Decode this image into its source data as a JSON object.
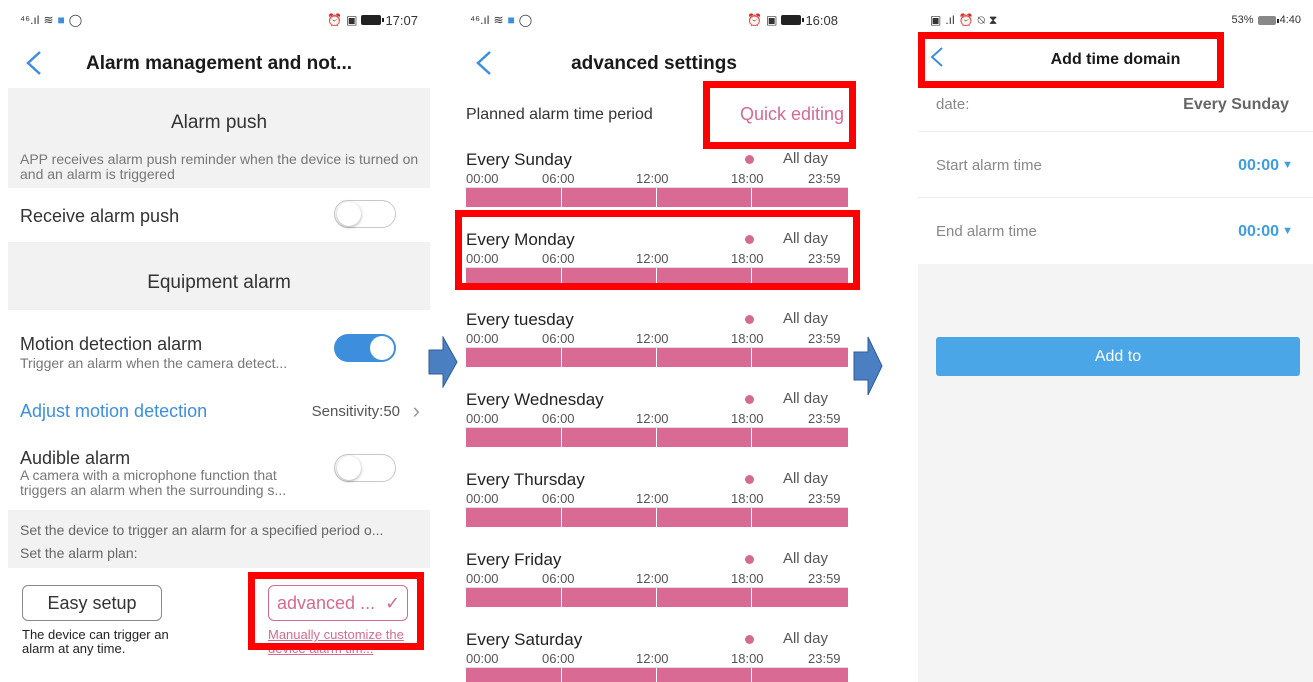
{
  "screen1": {
    "status": {
      "signal": "⁴⁶.ıl",
      "time": "17:07"
    },
    "title": "Alarm management and not...",
    "alarm_push": {
      "section_title": "Alarm push",
      "description": "APP receives alarm push reminder when the device is turned on and an alarm is triggered",
      "receive_label": "Receive alarm push",
      "receive_on": false
    },
    "equipment_alarm": {
      "section_title": "Equipment alarm",
      "motion_label": "Motion detection alarm",
      "motion_desc": "Trigger an alarm when the camera detect...",
      "motion_on": true,
      "adjust_label": "Adjust motion detection",
      "sensitivity": "Sensitivity:50",
      "audible_label": "Audible alarm",
      "audible_desc": "A camera with a microphone function that triggers an alarm when the surrounding s...",
      "audible_on": false
    },
    "plan": {
      "desc": "Set the device to trigger an alarm for a specified period o...",
      "label": "Set the alarm plan:",
      "easy_label": "Easy setup",
      "easy_desc": "The device can trigger an alarm at any time.",
      "advanced_label": "advanced ...",
      "advanced_desc": "Manually customize the device alarm tim..."
    }
  },
  "screen2": {
    "status": {
      "signal": "⁴⁶.ıl",
      "time": "16:08"
    },
    "title": "advanced settings",
    "plan_label": "Planned alarm time period",
    "quick_edit": "Quick editing",
    "all_day_label": "All day",
    "ticks": [
      "00:00",
      "06:00",
      "12:00",
      "18:00",
      "23:59"
    ],
    "days": [
      {
        "name": "Every Sunday"
      },
      {
        "name": "Every Monday"
      },
      {
        "name": "Every tuesday"
      },
      {
        "name": "Every Wednesday"
      },
      {
        "name": "Every Thursday"
      },
      {
        "name": "Every Friday"
      },
      {
        "name": "Every Saturday"
      }
    ]
  },
  "screen3": {
    "status": {
      "battery": "53%",
      "time": "4:40"
    },
    "title": "Add time domain",
    "date_label": "date:",
    "date_value": "Every Sunday",
    "start_label": "Start alarm time",
    "start_value": "00:00",
    "end_label": "End alarm time",
    "end_value": "00:00",
    "add_label": "Add to"
  },
  "colors": {
    "accent_blue": "#3d8fde",
    "accent_pink": "#d46b8f",
    "bar_pink": "#d96a93",
    "highlight_red": "#ff0000",
    "arrow_blue": "#4a7fc1"
  }
}
